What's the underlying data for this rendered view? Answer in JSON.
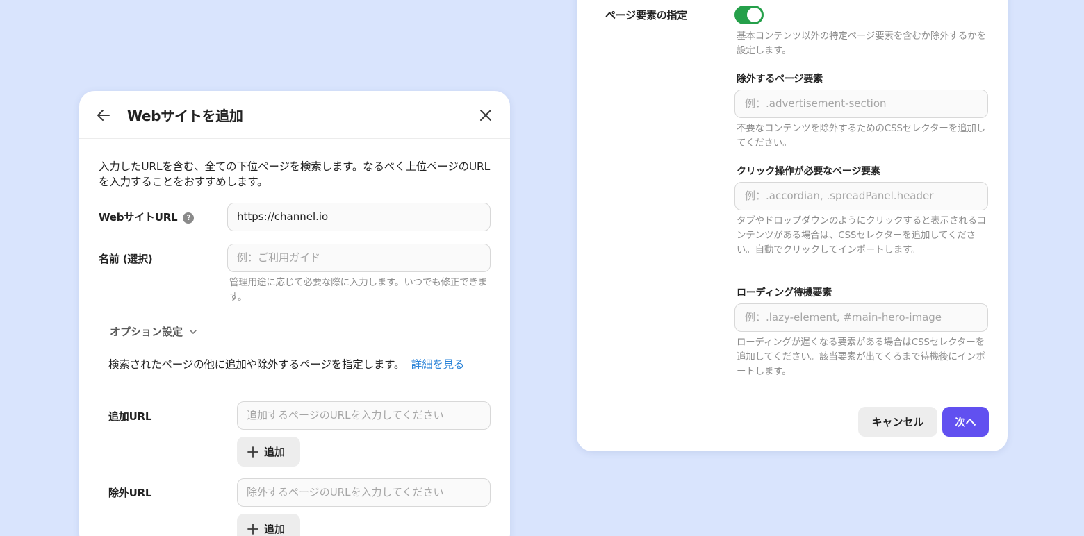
{
  "left_panel": {
    "title": "Webサイトを追加",
    "description": "入力したURLを含む、全ての下位ページを検索します。なるべく上位ページのURLを入力することをおすすめします。",
    "url_label": "WebサイトURL",
    "url_help_icon": "?",
    "url_value": "https://channel.io",
    "name_label": "名前 (選択)",
    "name_placeholder": "例：ご利用ガイド",
    "name_hint": "管理用途に応じて必要な際に入力します。いつでも修正できます。",
    "options_label": "オプション設定",
    "options_description": "検索されたページの他に追加や除外するページを指定します。",
    "options_link": "詳細を見る",
    "add_url_label": "追加URL",
    "add_url_placeholder": "追加するページのURLを入力してください",
    "add_button_label": "追加",
    "exclude_url_label": "除外URL",
    "exclude_url_placeholder": "除外するページのURLを入力してください",
    "exclude_add_button_label": "追加"
  },
  "right_panel": {
    "page_elements_label": "ページ要素の指定",
    "page_elements_toggle_on": true,
    "page_elements_hint": "基本コンテンツ以外の特定ページ要素を含むか除外するかを設定します。",
    "exclude_elements_label": "除外するページ要素",
    "exclude_elements_placeholder": "例：.advertisement-section",
    "exclude_elements_hint": "不要なコンテンツを除外するためのCSSセレクターを追加してください。",
    "click_elements_label": "クリック操作が必要なページ要素",
    "click_elements_placeholder": "例：.accordian, .spreadPanel.header",
    "click_elements_hint": "タブやドロップダウンのようにクリックすると表示されるコンテンツがある場合は、CSSセレクターを追加してください。自動でクリックしてインポートします。",
    "loading_elements_label": "ローディング待機要素",
    "loading_elements_placeholder": "例：.lazy-element, #main-hero-image",
    "loading_elements_hint": "ローディングが遅くなる要素がある場合はCSSセレクターを追加してください。該当要素が出てくるまで待機後にインポートします。",
    "cancel_label": "キャンセル",
    "next_label": "次へ"
  },
  "icons": {
    "back": "arrow-left-icon",
    "close": "close-icon",
    "chevron": "chevron-down-icon",
    "plus": "plus-icon",
    "help": "question-icon"
  },
  "colors": {
    "background": "#d9e4fd",
    "toggle_on": "#25a04a",
    "primary_button": "#6150f0",
    "link": "#2a83d8"
  }
}
